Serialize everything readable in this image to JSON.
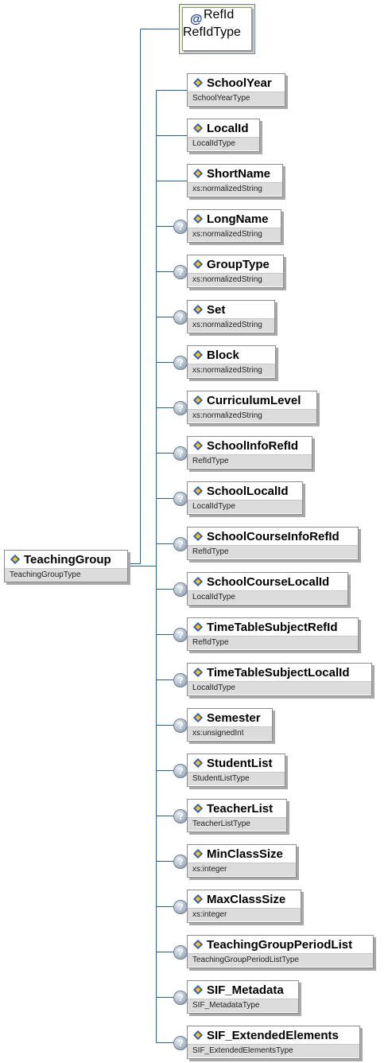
{
  "colors": {
    "connector": "#2d5f8b",
    "attribute_bg": "#eef3d8",
    "type_bg": "#dcdcdc"
  },
  "icons": {
    "element": "element-diamond-icon",
    "optional": "question-mark-icon",
    "attribute": "at-sign-icon"
  },
  "root": {
    "name": "TeachingGroup",
    "type": "TeachingGroupType"
  },
  "attribute": {
    "symbol": "@",
    "name": "RefId",
    "type": "RefIdType"
  },
  "optional_symbol": "?",
  "children": [
    {
      "name": "SchoolYear",
      "type": "SchoolYearType",
      "optional": false
    },
    {
      "name": "LocalId",
      "type": "LocalIdType",
      "optional": false
    },
    {
      "name": "ShortName",
      "type": "xs:normalizedString",
      "optional": false
    },
    {
      "name": "LongName",
      "type": "xs:normalizedString",
      "optional": true
    },
    {
      "name": "GroupType",
      "type": "xs:normalizedString",
      "optional": true
    },
    {
      "name": "Set",
      "type": "xs:normalizedString",
      "optional": true
    },
    {
      "name": "Block",
      "type": "xs:normalizedString",
      "optional": true
    },
    {
      "name": "CurriculumLevel",
      "type": "xs:normalizedString",
      "optional": true
    },
    {
      "name": "SchoolInfoRefId",
      "type": "RefIdType",
      "optional": true
    },
    {
      "name": "SchoolLocalId",
      "type": "LocalIdType",
      "optional": true
    },
    {
      "name": "SchoolCourseInfoRefId",
      "type": "RefIdType",
      "optional": true
    },
    {
      "name": "SchoolCourseLocalId",
      "type": "LocalIdType",
      "optional": true
    },
    {
      "name": "TimeTableSubjectRefId",
      "type": "RefIdType",
      "optional": true
    },
    {
      "name": "TimeTableSubjectLocalId",
      "type": "LocalIdType",
      "optional": true
    },
    {
      "name": "Semester",
      "type": "xs:unsignedInt",
      "optional": true
    },
    {
      "name": "StudentList",
      "type": "StudentListType",
      "optional": true
    },
    {
      "name": "TeacherList",
      "type": "TeacherListType",
      "optional": true
    },
    {
      "name": "MinClassSize",
      "type": "xs:integer",
      "optional": true
    },
    {
      "name": "MaxClassSize",
      "type": "xs:integer",
      "optional": true
    },
    {
      "name": "TeachingGroupPeriodList",
      "type": "TeachingGroupPeriodListType",
      "optional": true
    },
    {
      "name": "SIF_Metadata",
      "type": "SIF_MetadataType",
      "optional": true
    },
    {
      "name": "SIF_ExtendedElements",
      "type": "SIF_ExtendedElementsType",
      "optional": true
    }
  ]
}
